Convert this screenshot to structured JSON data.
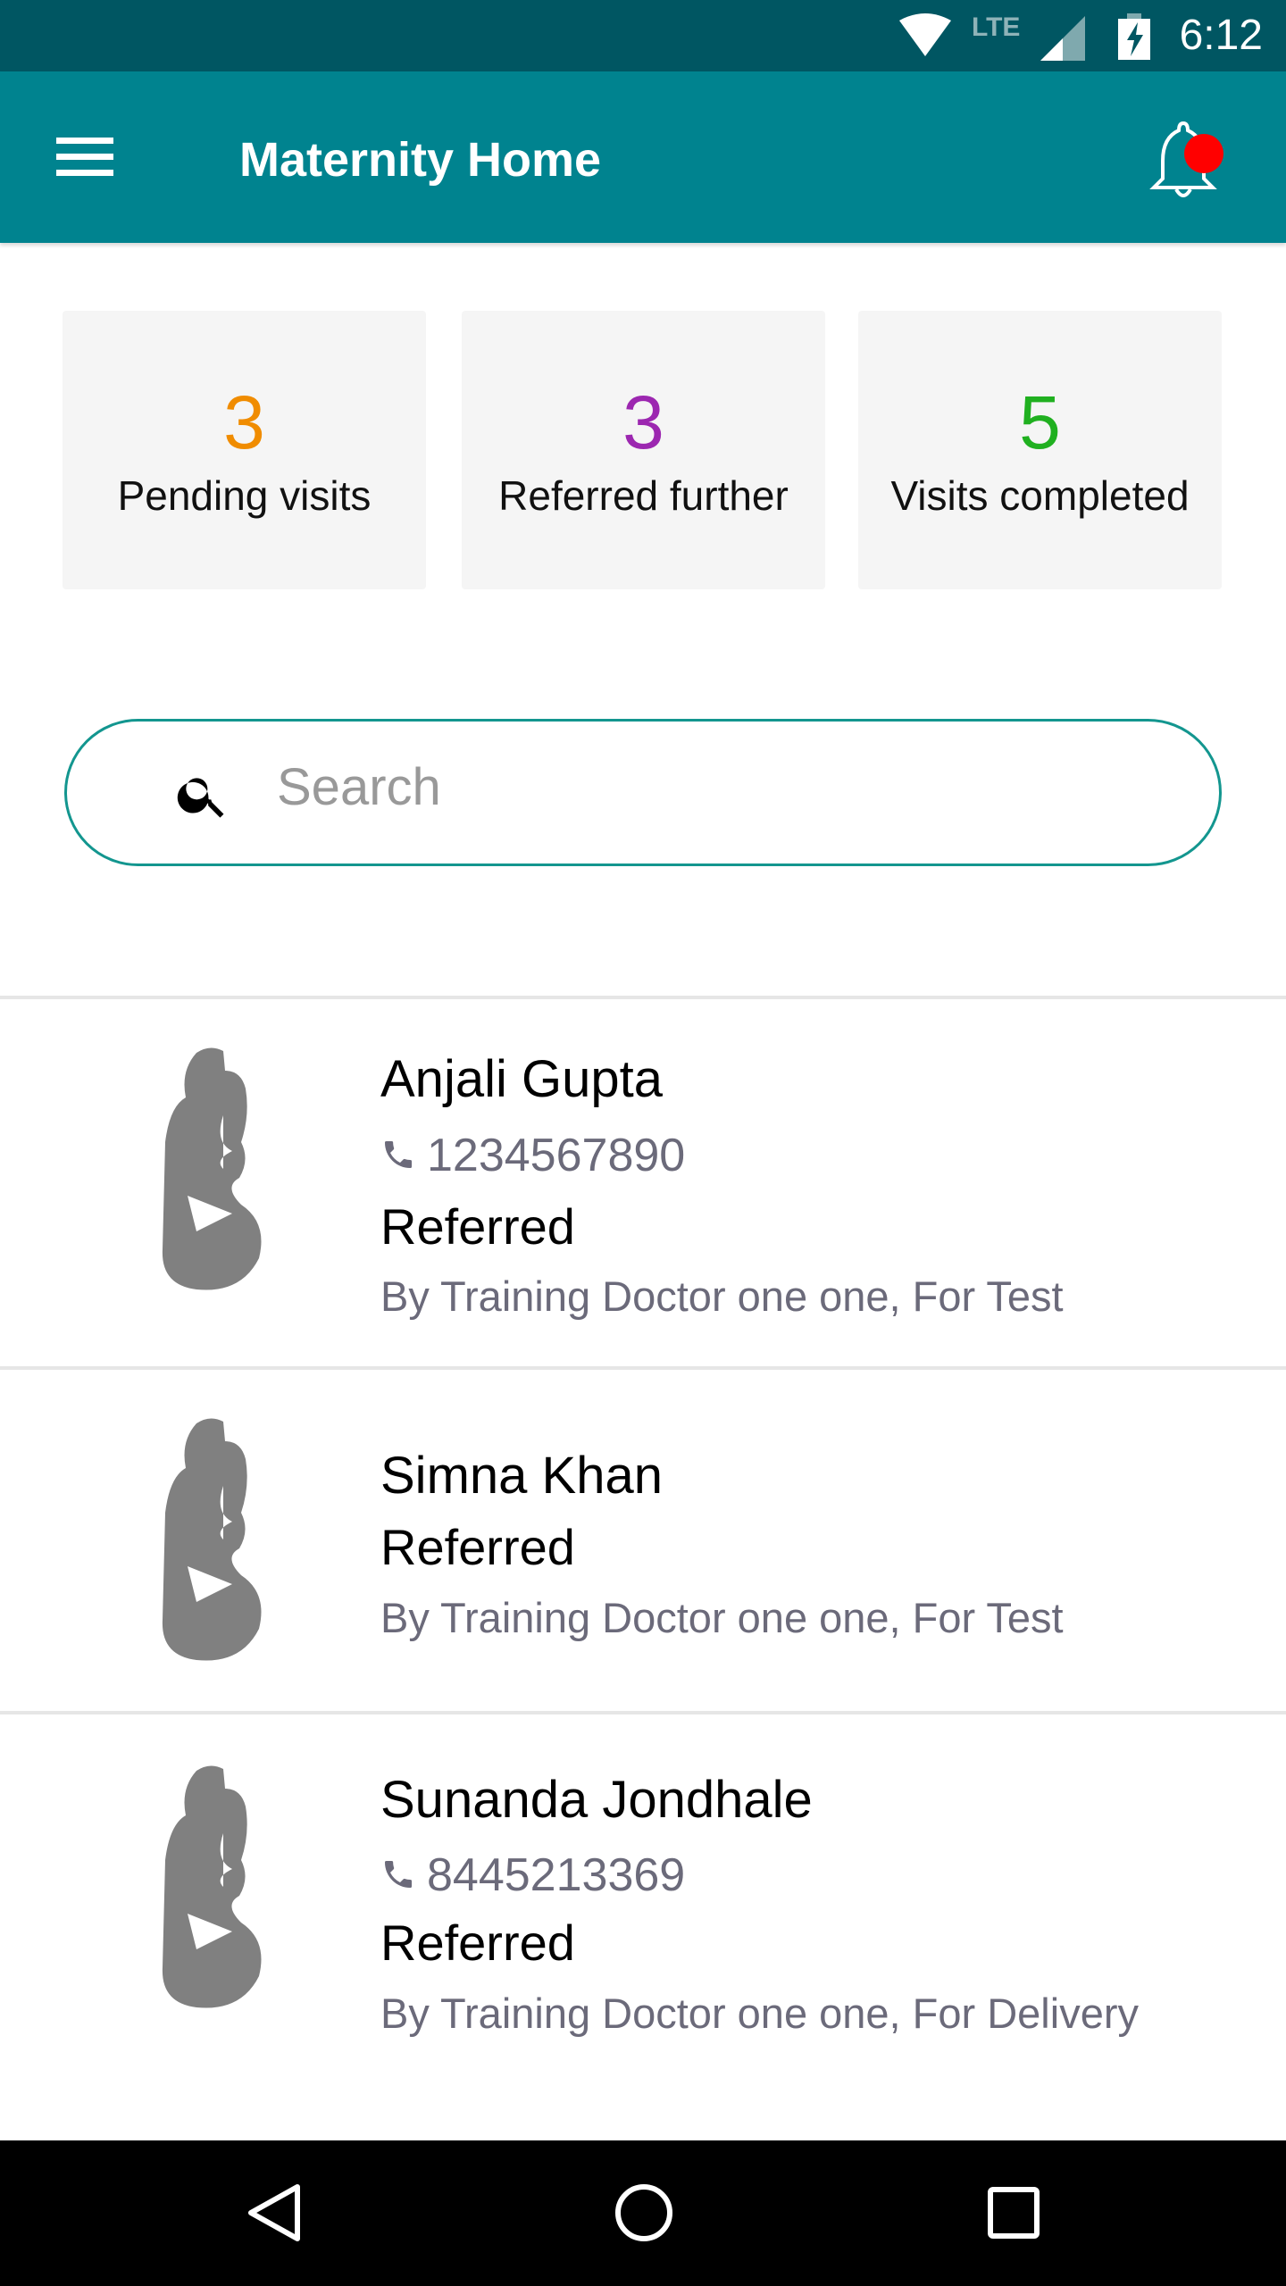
{
  "status_bar": {
    "network": "LTE",
    "time": "6:12"
  },
  "app_bar": {
    "title": "Maternity Home",
    "notification_dot_color": "#ff0000"
  },
  "stats": [
    {
      "value": "3",
      "label": "Pending visits",
      "color": "#f08c00"
    },
    {
      "value": "3",
      "label": "Referred further",
      "color": "#9c27b0"
    },
    {
      "value": "5",
      "label": "Visits completed",
      "color": "#20b020"
    }
  ],
  "search": {
    "placeholder": "Search",
    "value": ""
  },
  "patients": [
    {
      "name": "Anjali Gupta",
      "phone": "1234567890",
      "status": "Referred",
      "detail": "By Training Doctor one one, For Test"
    },
    {
      "name": "Simna Khan",
      "status": "Referred",
      "detail": "By Training Doctor one one, For Test"
    },
    {
      "name": "Sunanda Jondhale",
      "phone": "8445213369",
      "status": "Referred",
      "detail": "By Training Doctor one one, For Delivery"
    }
  ]
}
